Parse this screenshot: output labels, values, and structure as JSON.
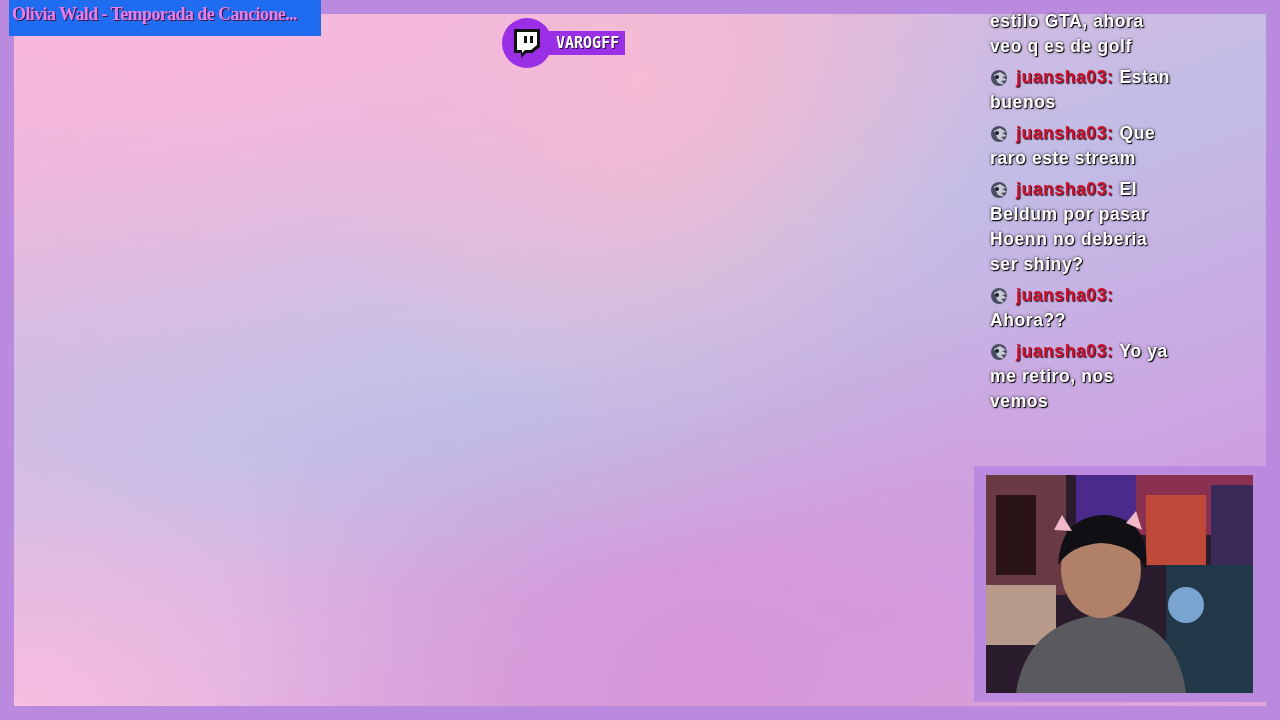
{
  "now_playing": {
    "title": "Olivia Wald - Temporada de Cancione..."
  },
  "channel_badge": {
    "name": "VAROGFF"
  },
  "chat": [
    {
      "kind": "continuation",
      "lines": [
        "estilo GTA, ahora",
        "veo q es de golf"
      ]
    },
    {
      "kind": "message",
      "user": "juansha03:",
      "head_text": "Estan",
      "lines": [
        "buenos"
      ]
    },
    {
      "kind": "message",
      "user": "juansha03:",
      "head_text": "Que",
      "lines": [
        "raro este stream"
      ]
    },
    {
      "kind": "message",
      "user": "juansha03:",
      "head_text": "El",
      "lines": [
        "Beldum por pasar",
        "Hoenn no deberia",
        "ser shiny?"
      ]
    },
    {
      "kind": "message",
      "user": "juansha03:",
      "lines": [
        "Ahora??"
      ]
    },
    {
      "kind": "message",
      "user": "juansha03:",
      "head_text": "Yo ya",
      "lines": [
        "me retiro, nos",
        "vemos"
      ]
    }
  ]
}
